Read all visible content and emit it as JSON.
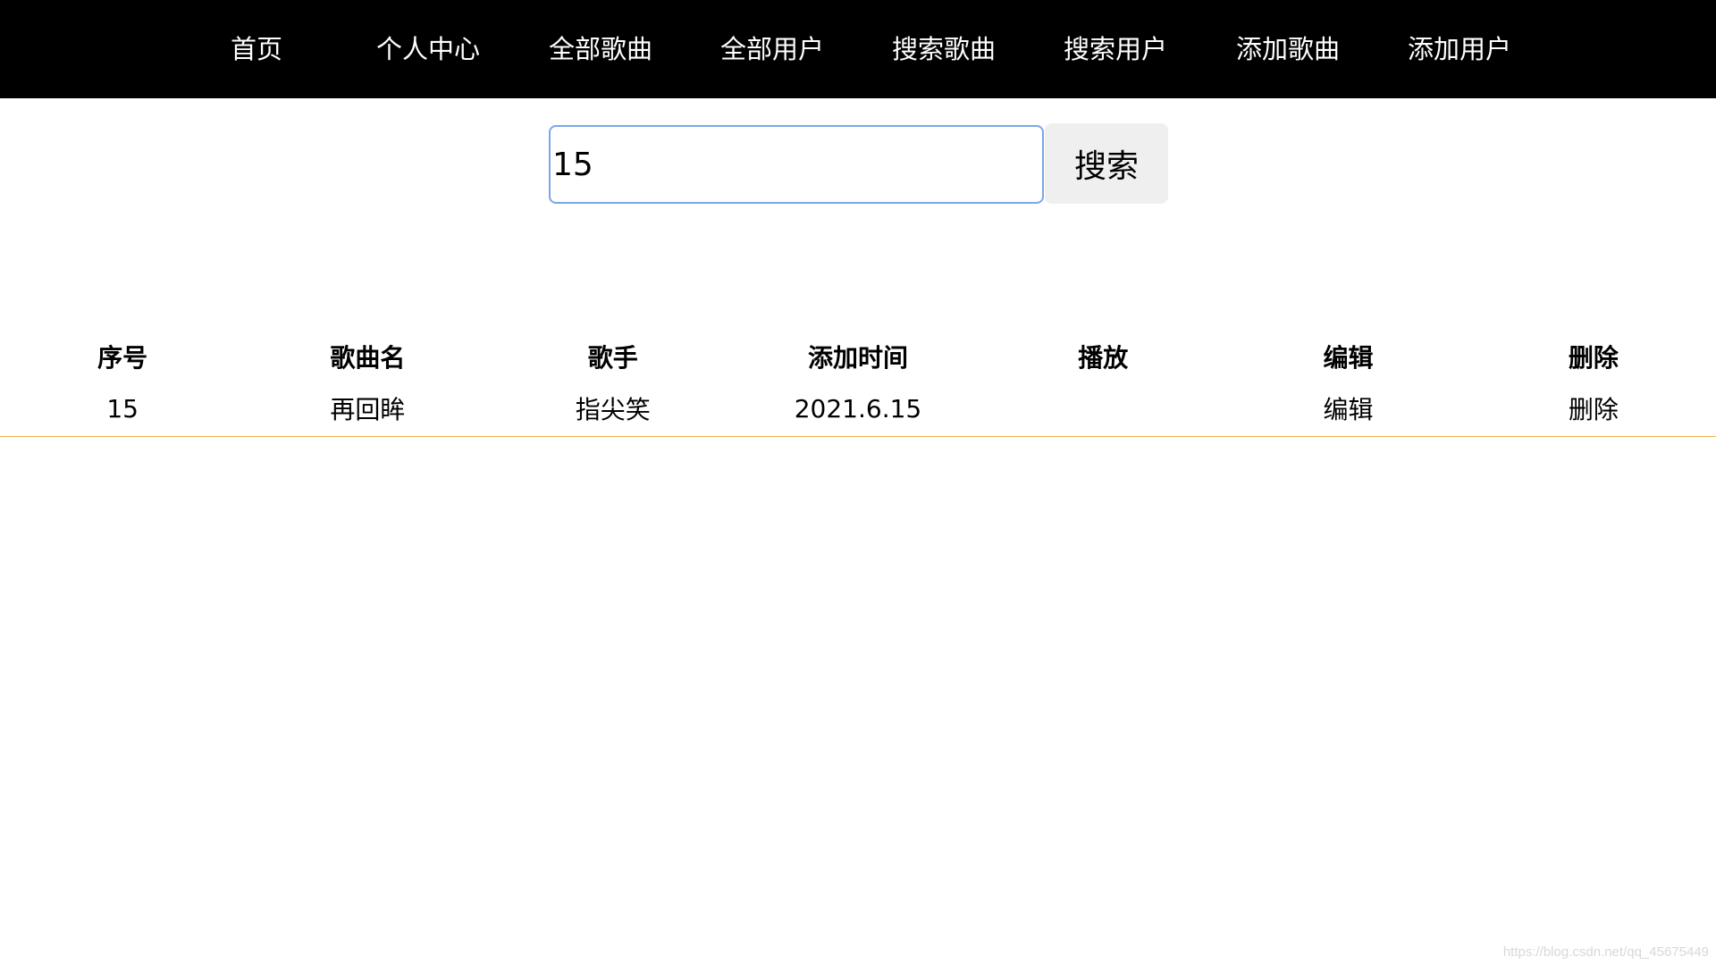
{
  "nav": {
    "items": [
      {
        "label": "首页"
      },
      {
        "label": "个人中心"
      },
      {
        "label": "全部歌曲"
      },
      {
        "label": "全部用户"
      },
      {
        "label": "搜索歌曲"
      },
      {
        "label": "搜索用户"
      },
      {
        "label": "添加歌曲"
      },
      {
        "label": "添加用户"
      }
    ]
  },
  "search": {
    "value": "15",
    "button_label": "搜索"
  },
  "table": {
    "headers": [
      "序号",
      "歌曲名",
      "歌手",
      "添加时间",
      "播放",
      "编辑",
      "删除"
    ],
    "rows": [
      {
        "id": "15",
        "song": "再回眸",
        "singer": "指尖笑",
        "added": "2021.6.15",
        "play": "",
        "edit": "编辑",
        "delete": "删除"
      }
    ]
  },
  "watermark": "https://blog.csdn.net/qq_45675449",
  "colors": {
    "nav_bg": "#000000",
    "input_border": "#7aa7e6",
    "row_border": "#e9b44c",
    "button_bg": "#efefef"
  }
}
